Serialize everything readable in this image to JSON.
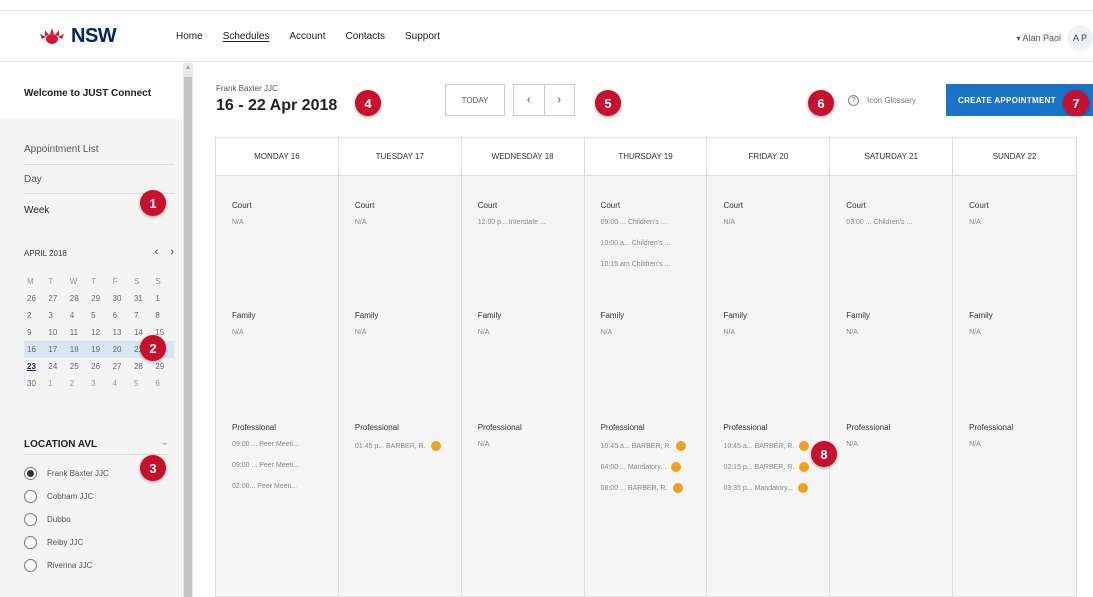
{
  "brand": {
    "logo_text": "NSW"
  },
  "nav": {
    "items": [
      "Home",
      "Schedules",
      "Account",
      "Contacts",
      "Support"
    ]
  },
  "user": {
    "name": "Alan Paol",
    "initials": "A P"
  },
  "sidebar": {
    "welcome": "Welcome to JUST Connect",
    "links": [
      "Appointment List",
      "Day",
      "Week"
    ],
    "calendar": {
      "month": "APRIL 2018",
      "prev": "‹",
      "next": "›",
      "weekdays": [
        "M",
        "T",
        "W",
        "T",
        "F",
        "S",
        "S"
      ],
      "weeks": [
        [
          "26",
          "27",
          "28",
          "29",
          "30",
          "31",
          "1"
        ],
        [
          "2",
          "3",
          "4",
          "5",
          "6",
          "7",
          "8"
        ],
        [
          "9",
          "10",
          "11",
          "12",
          "13",
          "14",
          "15"
        ],
        [
          "16",
          "17",
          "18",
          "19",
          "20",
          "21",
          "22"
        ],
        [
          "23",
          "24",
          "25",
          "26",
          "27",
          "28",
          "29"
        ],
        [
          "30",
          "1",
          "2",
          "3",
          "4",
          "5",
          "6"
        ]
      ]
    },
    "location": {
      "title": "LOCATION AVL",
      "options": [
        "Frank Baxter JJC",
        "Cobham JJC",
        "Dubbo",
        "Reiby JJC",
        "Riverina JJC"
      ],
      "selected": "Frank Baxter JJC"
    }
  },
  "header": {
    "center_name": "Frank Baxter JJC",
    "date_range": "16 - 22 Apr 2018",
    "today_label": "TODAY",
    "prev": "‹",
    "next": "›",
    "glossary_label": "Icon Glossary",
    "create_label": "CREATE APPOINTMENT"
  },
  "week": {
    "days": [
      {
        "label": "MONDAY 16",
        "court": [
          "N/A"
        ],
        "family": [
          "N/A"
        ],
        "professional": [
          "09:00 ...  Peer Meeti...",
          "09:00 ...  Peer Meeti...",
          "02:00...  Peer Meeti..."
        ],
        "professional_warn": [
          false,
          false,
          false
        ]
      },
      {
        "label": "TUESDAY 17",
        "court": [
          "N/A"
        ],
        "family": [
          "N/A"
        ],
        "professional": [
          "01:45 p...  BARBER, R."
        ],
        "professional_warn": [
          true
        ]
      },
      {
        "label": "WEDNESDAY 18",
        "court": [
          "12:00 p...  Interstate ..."
        ],
        "family": [
          "N/A"
        ],
        "professional": [
          "N/A"
        ],
        "professional_warn": [
          false
        ]
      },
      {
        "label": "THURSDAY 19",
        "court": [
          "09:00 ...  Children's ...",
          "10:00 a...  Children's ...",
          "10:15 am  Children's ..."
        ],
        "family": [
          "N/A"
        ],
        "professional": [
          "10:45 a...  BARBER, R.",
          "04:00 ...  Mandatory...",
          "08:00 ...  BARBER, R."
        ],
        "professional_warn": [
          true,
          true,
          true
        ]
      },
      {
        "label": "FRIDAY 20",
        "court": [
          "N/A"
        ],
        "family": [
          "N/A"
        ],
        "professional": [
          "10:45 a...  BARBER, R.",
          "02:15 p...  BARBER, R.",
          "03:35 p...  Mandatory..."
        ],
        "professional_warn": [
          true,
          true,
          true
        ]
      },
      {
        "label": "SATURDAY 21",
        "court": [
          "03:00 ...  Children's ..."
        ],
        "family": [
          "N/A"
        ],
        "professional": [
          "N/A"
        ],
        "professional_warn": [
          false
        ]
      },
      {
        "label": "SUNDAY 22",
        "court": [
          "N/A"
        ],
        "family": [
          "N/A"
        ],
        "professional": [
          "N/A"
        ],
        "professional_warn": [
          false
        ]
      }
    ],
    "section_titles": {
      "court": "Court",
      "family": "Family",
      "professional": "Professional"
    }
  },
  "markers": [
    "1",
    "2",
    "3",
    "4",
    "5",
    "6",
    "7",
    "8"
  ],
  "colors": {
    "accent": "#1a74c8",
    "marker": "#c8102e",
    "brand": "#002664",
    "warning": "#f0a020",
    "selected_week": "#d6e6f2"
  }
}
